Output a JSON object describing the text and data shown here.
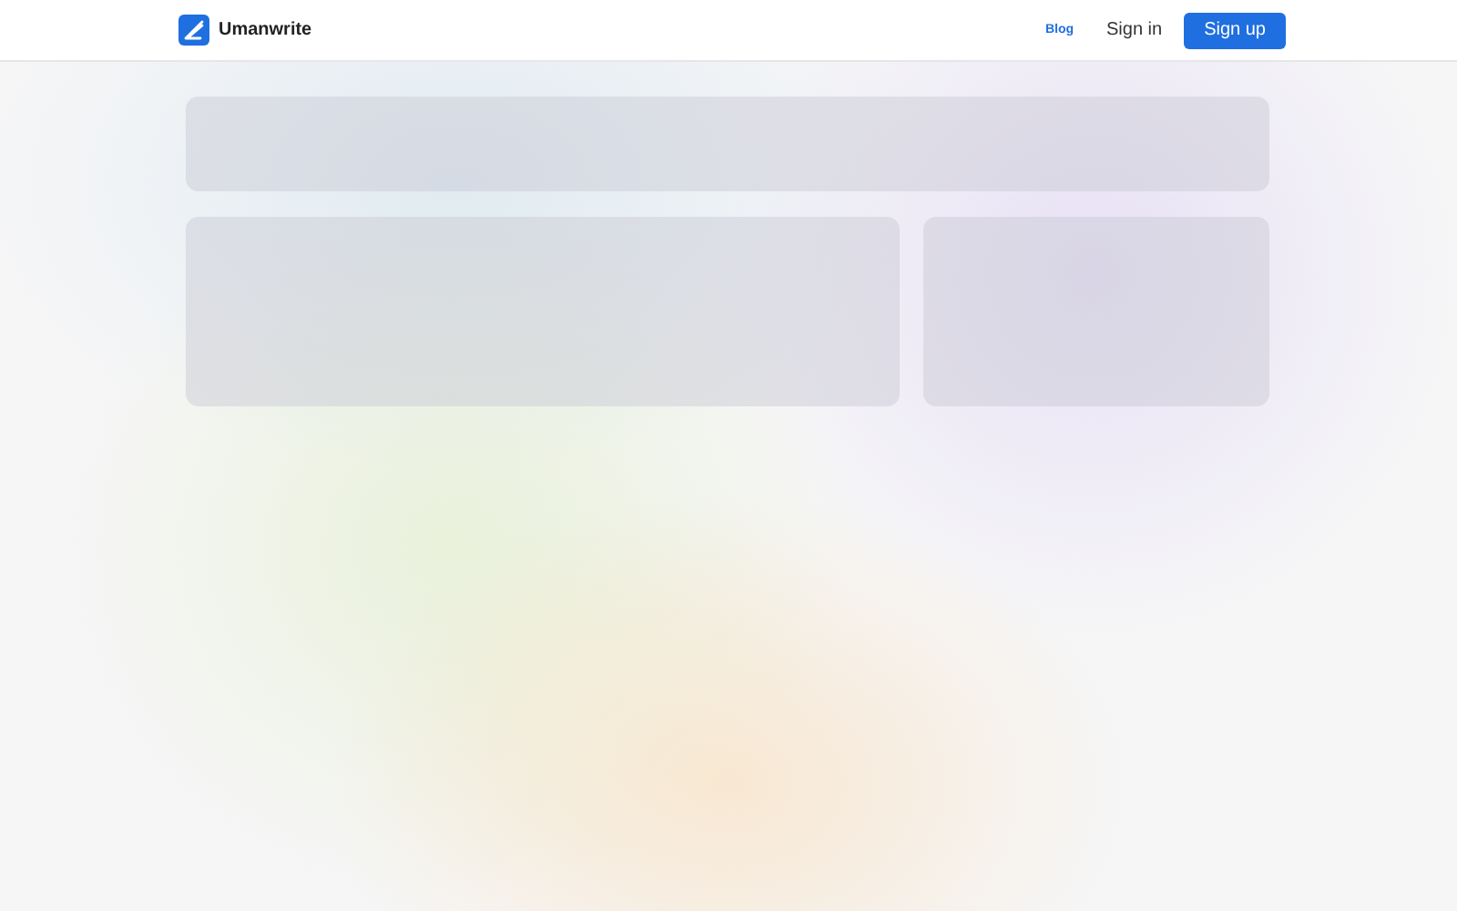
{
  "header": {
    "brand": "Umanwrite",
    "links": [
      {
        "label": "Blog",
        "kind": "link"
      },
      {
        "label": "Sign in",
        "kind": "text"
      },
      {
        "label": "Sign up",
        "kind": "primary"
      }
    ]
  }
}
